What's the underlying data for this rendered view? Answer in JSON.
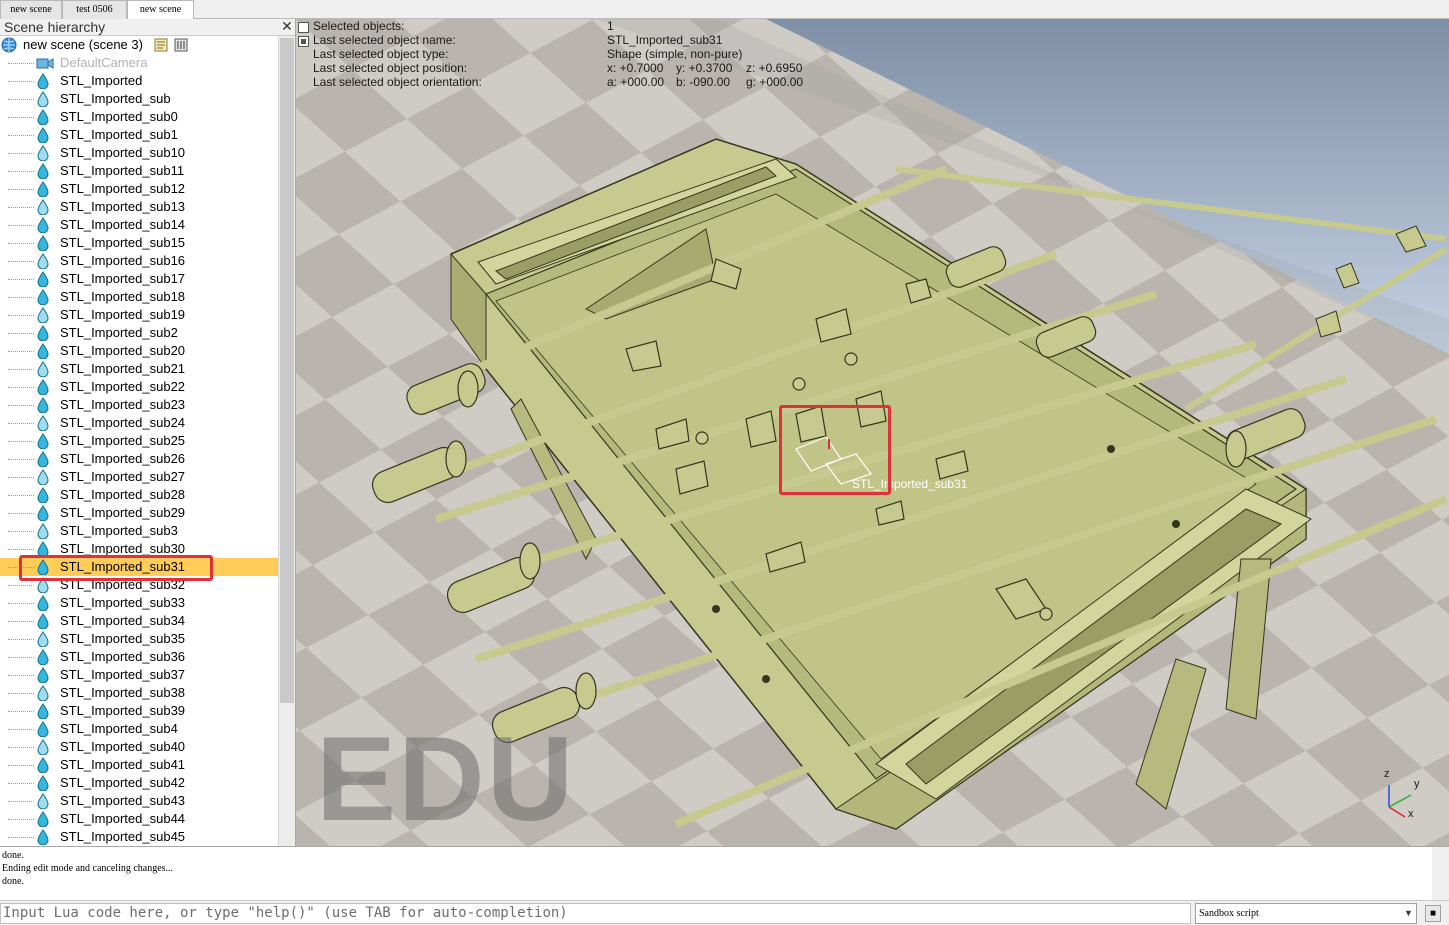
{
  "tabs": [
    {
      "label": "new scene",
      "active": false
    },
    {
      "label": "test 0506",
      "active": false
    },
    {
      "label": "new scene",
      "active": true
    }
  ],
  "hierarchy": {
    "title": "Scene hierarchy",
    "close_icon": "close-icon",
    "root_label": "new scene (scene 3)",
    "camera_label": "DefaultCamera",
    "items": [
      "STL_Imported",
      "STL_Imported_sub",
      "STL_Imported_sub0",
      "STL_Imported_sub1",
      "STL_Imported_sub10",
      "STL_Imported_sub11",
      "STL_Imported_sub12",
      "STL_Imported_sub13",
      "STL_Imported_sub14",
      "STL_Imported_sub15",
      "STL_Imported_sub16",
      "STL_Imported_sub17",
      "STL_Imported_sub18",
      "STL_Imported_sub19",
      "STL_Imported_sub2",
      "STL_Imported_sub20",
      "STL_Imported_sub21",
      "STL_Imported_sub22",
      "STL_Imported_sub23",
      "STL_Imported_sub24",
      "STL_Imported_sub25",
      "STL_Imported_sub26",
      "STL_Imported_sub27",
      "STL_Imported_sub28",
      "STL_Imported_sub29",
      "STL_Imported_sub3",
      "STL_Imported_sub30",
      "STL_Imported_sub31",
      "STL_Imported_sub32",
      "STL_Imported_sub33",
      "STL_Imported_sub34",
      "STL_Imported_sub35",
      "STL_Imported_sub36",
      "STL_Imported_sub37",
      "STL_Imported_sub38",
      "STL_Imported_sub39",
      "STL_Imported_sub4",
      "STL_Imported_sub40",
      "STL_Imported_sub41",
      "STL_Imported_sub42",
      "STL_Imported_sub43",
      "STL_Imported_sub44",
      "STL_Imported_sub45"
    ],
    "selected_item": "STL_Imported_sub31",
    "highlight_color": "#ffcd57"
  },
  "viewport": {
    "info_labels": [
      "Selected objects:",
      "Last selected object name:",
      "Last selected object type:",
      "Last selected object position:",
      "Last selected object orientation:"
    ],
    "info_values": {
      "count": "1",
      "name": "STL_Imported_sub31",
      "type": "Shape (simple, non-pure)",
      "pos_x": "x: +0.7000",
      "pos_y": "y: +0.3700",
      "pos_z": "z: +0.6950",
      "ori_a": "a: +000.00",
      "ori_b": "b: -090.00",
      "ori_g": "g: +000.00"
    },
    "watermark": "EDU",
    "object_label": "STL_Imported_sub31",
    "axes": {
      "z": "z",
      "y": "y",
      "x": "x"
    },
    "table_color": "#c6ca8f",
    "highlight_color": "#e0303b"
  },
  "console": {
    "lines": [
      "done.",
      "Ending edit mode and canceling changes...",
      "done."
    ]
  },
  "input": {
    "placeholder": "Input Lua code here, or type \"help()\" (use TAB for auto-completion)",
    "script_selector": "Sandbox script",
    "caret_icon": "chevron-down-icon",
    "button_icon": "toggle-icon"
  }
}
